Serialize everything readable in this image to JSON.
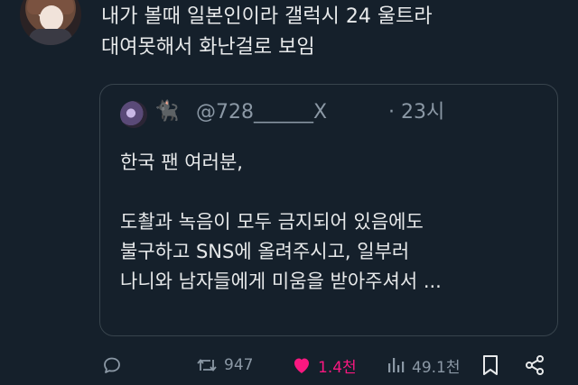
{
  "tweet": {
    "text": "내가 볼때 일본인이라 갤럭시 24 울트라\n대여못해서 화난걸로 보임"
  },
  "quote": {
    "emoji": "🐈‍⬛",
    "handle": "@728______X",
    "time": "· 23시",
    "paragraphs": [
      "한국 팬 여러분,",
      " 도촬과 녹음이 모두 금지되어 있음에도\n불구하고 SNS에 올려주시고, 일부러\n나니와 남자들에게 미움을 받아주셔서 ..."
    ]
  },
  "actions": {
    "retweets": "947",
    "likes": "1.4천",
    "views": "49.1천"
  },
  "colors": {
    "background": "#15202b",
    "text": "#e7e9ea",
    "muted": "#8b98a5",
    "like": "#f91880",
    "border": "#38444d"
  }
}
